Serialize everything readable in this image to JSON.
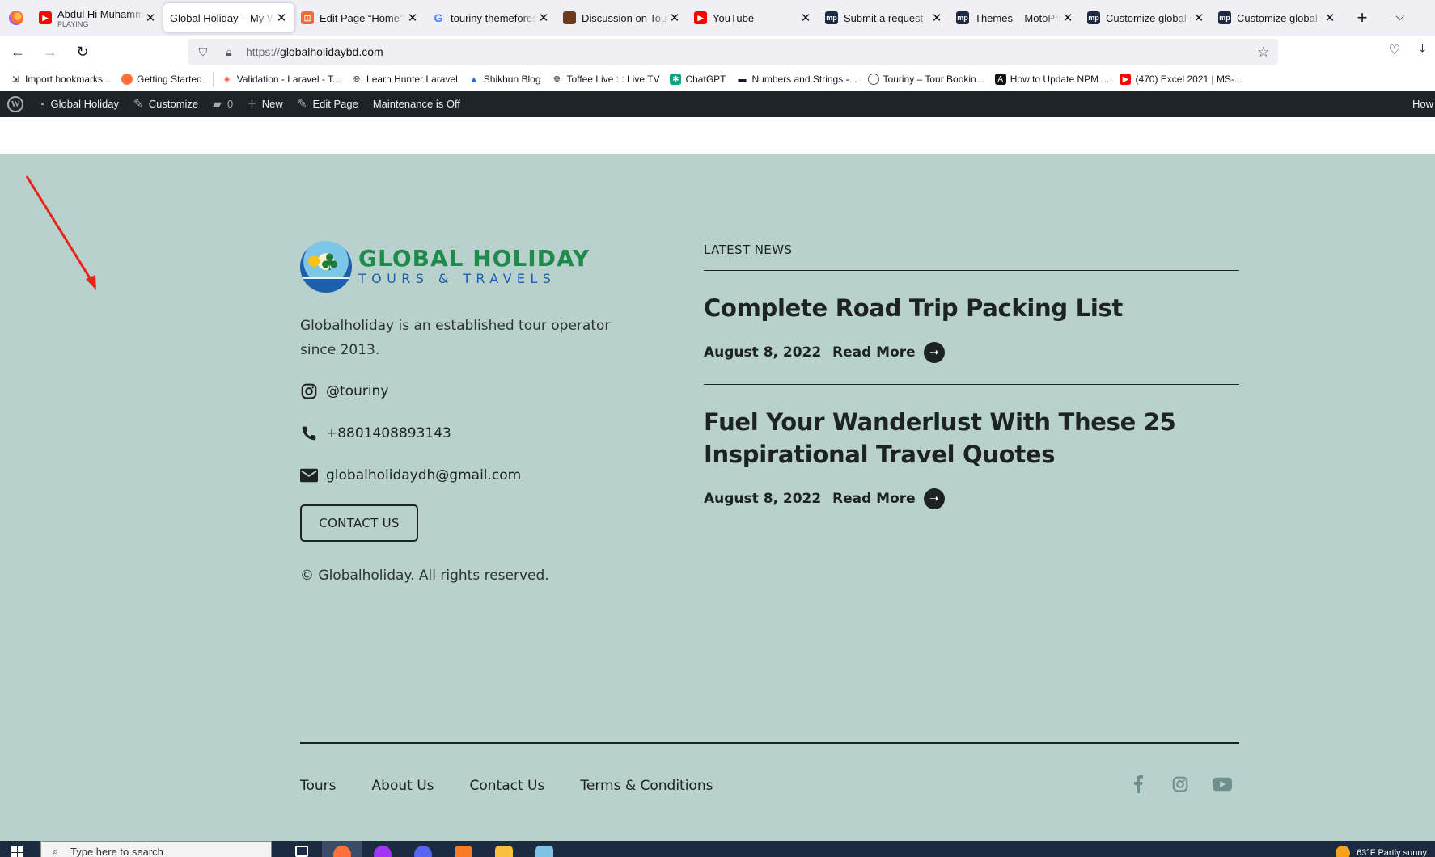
{
  "browser": {
    "tabs": [
      {
        "title": "Abdul Hi Muhammad",
        "subtitle": "PLAYING",
        "favicon": "youtube-icon",
        "active": false
      },
      {
        "title": "Global Holiday – My Wo",
        "favicon": "",
        "active": true
      },
      {
        "title": "Edit Page “Home” ‹",
        "favicon": "edit-icon",
        "active": false
      },
      {
        "title": "touriny themeforest",
        "favicon": "google-icon",
        "active": false
      },
      {
        "title": "Discussion on Tour",
        "favicon": "book-icon",
        "active": false
      },
      {
        "title": "YouTube",
        "favicon": "youtube-icon",
        "active": false
      },
      {
        "title": "Submit a request – M",
        "favicon": "motopress-icon",
        "active": false
      },
      {
        "title": "Themes – MotoPress",
        "favicon": "motopress-icon",
        "active": false
      },
      {
        "title": "Customize global se",
        "favicon": "motopress-icon",
        "active": false
      },
      {
        "title": "Customize global se",
        "favicon": "motopress-icon",
        "active": false
      }
    ],
    "url_protocol": "https://",
    "url_host": "globalholidaybd.com",
    "bookmarks": [
      {
        "label": "Import bookmarks...",
        "icon": "import-icon"
      },
      {
        "label": "Getting Started",
        "icon": "firefox-icon"
      },
      {
        "label": "Validation - Laravel - T...",
        "icon": "laravel-icon"
      },
      {
        "label": "Learn Hunter Laravel",
        "icon": "globe-icon"
      },
      {
        "label": "Shikhun Blog",
        "icon": "cap-icon"
      },
      {
        "label": "Toffee Live : : Live TV",
        "icon": "globe-icon"
      },
      {
        "label": "ChatGPT",
        "icon": "openai-icon"
      },
      {
        "label": "Numbers and Strings -...",
        "icon": "hat-icon"
      },
      {
        "label": "Touriny – Tour Bookin...",
        "icon": "touriny-icon"
      },
      {
        "label": "How to Update NPM ...",
        "icon": "a-icon"
      },
      {
        "label": "(470) Excel 2021 | MS-...",
        "icon": "youtube-icon"
      }
    ]
  },
  "wp_admin": {
    "site_name": "Global Holiday",
    "customize": "Customize",
    "comments_count": "0",
    "new": "New",
    "edit_page": "Edit Page",
    "maintenance": "Maintenance is Off",
    "howdy": "How"
  },
  "footer": {
    "logo_title": "GLOBAL HOLIDAY",
    "logo_subtitle": "TOURS & TRAVELS",
    "logo_badge_text": "GLOBAL HOLIDAY",
    "description": "Globalholiday is an established tour operator since 2013.",
    "instagram": "@touriny",
    "phone": "+8801408893143",
    "email": "globalholidaydh@gmail.com",
    "contact_button": "CONTACT US",
    "copyright": "© Globalholiday. All rights reserved.",
    "news_label": "LATEST NEWS",
    "news": [
      {
        "title": "Complete Road Trip Packing List",
        "date": "August 8, 2022",
        "read_more": "Read More"
      },
      {
        "title": "Fuel Your Wanderlust With These 25 Inspirational Travel Quotes",
        "date": "August 8, 2022",
        "read_more": "Read More"
      }
    ],
    "bottom_nav": [
      "Tours",
      "About Us",
      "Contact Us",
      "Terms & Conditions"
    ],
    "social": [
      "facebook-icon",
      "instagram-icon",
      "youtube-icon"
    ]
  },
  "taskbar": {
    "search_placeholder": "Type here to search",
    "weather": "63°F  Partly sunny"
  },
  "colors": {
    "footer_bg": "#b8d1cd",
    "wp_bar": "#1d2327",
    "logo_green": "#1f8a4c",
    "logo_blue": "#1b5ea8",
    "annotation_arrow": "#e8231b"
  }
}
